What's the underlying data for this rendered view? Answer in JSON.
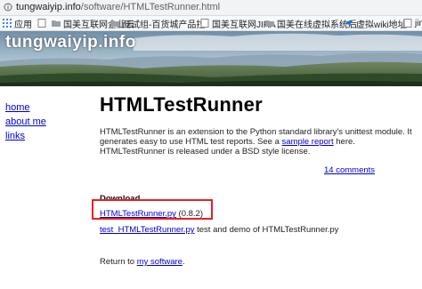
{
  "address_bar": {
    "host": "tungwaiyip.info",
    "path": "/software/HTMLTestRunner.html"
  },
  "bookmarks": [
    {
      "label": "应用",
      "icon": "apps-grid-icon"
    },
    {
      "label": "",
      "icon": "page-icon"
    },
    {
      "label": "国美互联网企业云",
      "icon": "folder-icon"
    },
    {
      "label": "测试组-百货城产品拉",
      "icon": "folder-icon"
    },
    {
      "label": "国美互联网JIRA",
      "icon": "page-icon"
    },
    {
      "label": "国美在线虚拟系统后",
      "icon": "folder-icon"
    },
    {
      "label": "虚拟wiki地址",
      "icon": "bird-icon"
    },
    {
      "label": "jin",
      "icon": "page-icon"
    }
  ],
  "site": {
    "title": "tungwaiyip.info"
  },
  "sidebar": {
    "links": [
      "home",
      "about me",
      "links"
    ]
  },
  "main": {
    "heading": "HTMLTestRunner",
    "desc_part1": "HTMLTestRunner is an extension to the Python standard library's unittest module. It generates easy to use HTML test reports. See a ",
    "desc_link": "sample report",
    "desc_part2": " here. HTMLTestRunner is released under a BSD style license.",
    "comments_link": "14 comments",
    "download_heading": "Download",
    "download_link": "HTMLTestRunner.py",
    "download_version": " (0.8.2)",
    "test_link": "test_HTMLTestRunner.py",
    "test_desc": " test and demo of HTMLTestRunner.py",
    "return_text": "Return to ",
    "return_link": "my software",
    "return_end": "."
  }
}
